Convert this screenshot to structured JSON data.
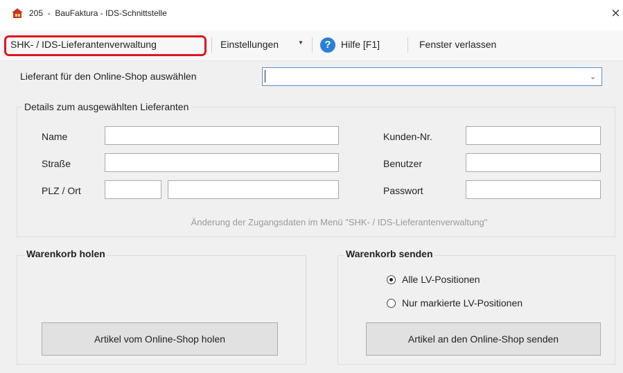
{
  "window": {
    "title": "205  -  BauFaktura - IDS-Schnittstelle",
    "close_glyph": "×",
    "icon": "app-logo-icon"
  },
  "menu": {
    "item_supplier_mgmt": "SHK- / IDS-Lieferantenverwaltung",
    "item_settings": "Einstellungen",
    "settings_arrow": "▼",
    "item_help": "Hilfe  [F1]",
    "help_icon_glyph": "?",
    "item_exit": "Fenster verlassen",
    "highlight_color": "#e0141e"
  },
  "supplier_select": {
    "label": "Lieferant für den Online-Shop auswählen",
    "value": "",
    "arrow": "⌄"
  },
  "details": {
    "title": "Details zum ausgewählten Lieferanten",
    "name_label": "Name",
    "street_label": "Straße",
    "zip_city_label": "PLZ / Ort",
    "customer_no_label": "Kunden-Nr.",
    "user_label": "Benutzer",
    "password_label": "Passwort",
    "name_value": "",
    "street_value": "",
    "zip_value": "",
    "city_value": "",
    "customer_no_value": "",
    "user_value": "",
    "password_value": "",
    "hint": "Änderung der Zugangsdaten im Menü \"SHK- / IDS-Lieferantenverwaltung\""
  },
  "cart_get": {
    "title": "Warenkorb holen",
    "button": "Artikel vom Online-Shop holen"
  },
  "cart_send": {
    "title": "Warenkorb senden",
    "option_all": "Alle LV-Positionen",
    "option_marked": "Nur markierte LV-Positionen",
    "selected": "all",
    "button": "Artikel an den Online-Shop senden"
  }
}
